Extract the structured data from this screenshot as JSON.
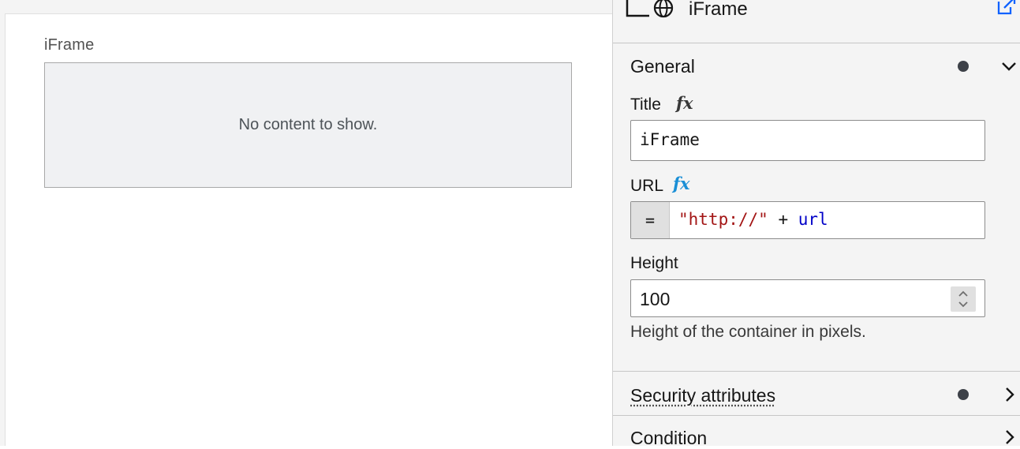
{
  "canvas": {
    "widget_title": "iFrame",
    "placeholder_text": "No content to show."
  },
  "panel": {
    "header": {
      "title": "iFrame",
      "icons": [
        "frame-corner-icon",
        "globe-icon",
        "open-in-new-icon"
      ]
    },
    "general": {
      "title": "General",
      "fields": {
        "title": {
          "label": "Title",
          "fx": "fx",
          "value": "iFrame"
        },
        "url": {
          "label": "URL",
          "fx": "fx",
          "prefix": "=",
          "expr_string": "\"http://\"",
          "expr_op": " + ",
          "expr_ident": "url"
        },
        "height": {
          "label": "Height",
          "value": "100",
          "helper": "Height of the container in pixels."
        }
      }
    },
    "security": {
      "title": "Security attributes"
    },
    "condition": {
      "title": "Condition"
    }
  },
  "colors": {
    "fx_active": "#1a8fd6",
    "string_token": "#a31515",
    "identifier_token": "#0000c8",
    "status_dot": "#3d4148"
  }
}
